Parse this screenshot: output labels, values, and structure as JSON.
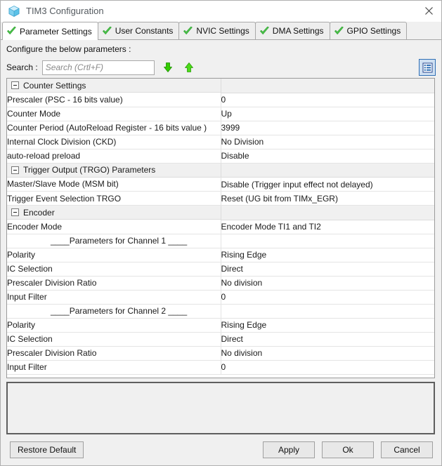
{
  "window": {
    "title": "TIM3 Configuration",
    "icon": "cube-icon",
    "close_label": "✕",
    "accent_color": "#2f6fb5",
    "check_color": "#3cb521"
  },
  "tabs": [
    {
      "label": "Parameter Settings",
      "icon": "green-check-icon",
      "active": true
    },
    {
      "label": "User Constants",
      "icon": "green-check-icon",
      "active": false
    },
    {
      "label": "NVIC Settings",
      "icon": "green-check-icon",
      "active": false
    },
    {
      "label": "DMA Settings",
      "icon": "green-check-icon",
      "active": false
    },
    {
      "label": "GPIO Settings",
      "icon": "green-check-icon",
      "active": false
    }
  ],
  "instructions": "Configure the below parameters :",
  "search": {
    "label": "Search :",
    "value": "",
    "placeholder": "Search (Crtl+F)",
    "next_icon": "arrow-down-icon",
    "prev_icon": "arrow-up-icon",
    "view_toggle_icon": "list-view-icon"
  },
  "parameters": [
    {
      "type": "group",
      "name": "Counter Settings",
      "value": "",
      "expanded": true
    },
    {
      "type": "row",
      "name": "Prescaler (PSC - 16 bits value)",
      "value": "0"
    },
    {
      "type": "row",
      "name": "Counter Mode",
      "value": "Up"
    },
    {
      "type": "row",
      "name": "Counter Period (AutoReload Register - 16 bits value )",
      "value": "3999"
    },
    {
      "type": "row",
      "name": "Internal Clock Division (CKD)",
      "value": "No Division"
    },
    {
      "type": "row",
      "name": "auto-reload preload",
      "value": "Disable"
    },
    {
      "type": "group",
      "name": "Trigger Output (TRGO) Parameters",
      "value": "",
      "expanded": true
    },
    {
      "type": "row",
      "name": "Master/Slave Mode (MSM bit)",
      "value": "Disable (Trigger input effect not delayed)"
    },
    {
      "type": "row",
      "name": "Trigger Event Selection TRGO",
      "value": "Reset (UG bit from TIMx_EGR)"
    },
    {
      "type": "group",
      "name": "Encoder",
      "value": "",
      "expanded": true
    },
    {
      "type": "row",
      "name": "Encoder Mode",
      "value": "Encoder Mode TI1 and TI2"
    },
    {
      "type": "separator",
      "name": "____Parameters for Channel 1 ____",
      "value": ""
    },
    {
      "type": "row",
      "name": "Polarity",
      "value": "Rising Edge"
    },
    {
      "type": "row",
      "name": "IC Selection",
      "value": "Direct"
    },
    {
      "type": "row",
      "name": "Prescaler Division Ratio",
      "value": "No division"
    },
    {
      "type": "row",
      "name": "Input Filter",
      "value": "0"
    },
    {
      "type": "separator",
      "name": "____Parameters for Channel 2 ____",
      "value": ""
    },
    {
      "type": "row",
      "name": "Polarity",
      "value": "Rising Edge"
    },
    {
      "type": "row",
      "name": "IC Selection",
      "value": "Direct"
    },
    {
      "type": "row",
      "name": "Prescaler Division Ratio",
      "value": "No division"
    },
    {
      "type": "row",
      "name": "Input Filter",
      "value": "0"
    }
  ],
  "description_panel": {
    "text": ""
  },
  "buttons": {
    "restore_default": "Restore Default",
    "apply": "Apply",
    "ok": "Ok",
    "cancel": "Cancel"
  }
}
